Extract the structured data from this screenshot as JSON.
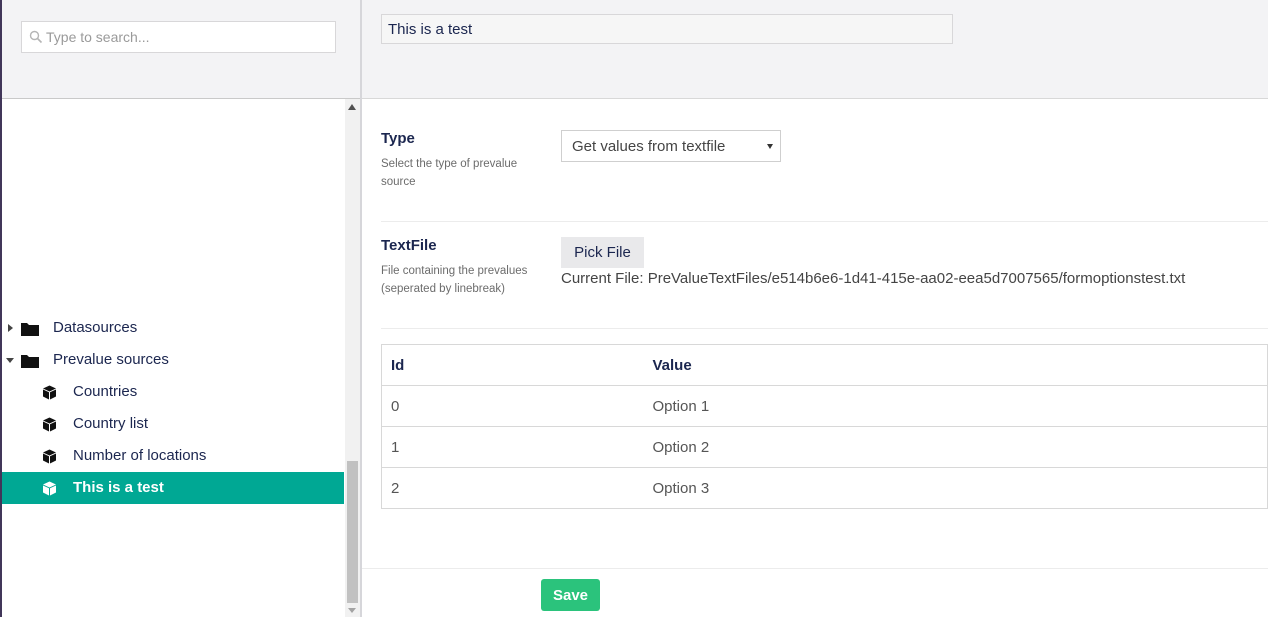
{
  "search": {
    "placeholder": "Type to search..."
  },
  "tree": {
    "items": [
      {
        "label": "Datasources",
        "icon": "folder-icon",
        "expanded": false
      },
      {
        "label": "Prevalue sources",
        "icon": "folder-icon",
        "expanded": true
      },
      {
        "label": "Countries",
        "icon": "box-icon"
      },
      {
        "label": "Country list",
        "icon": "box-icon"
      },
      {
        "label": "Number of locations",
        "icon": "box-icon"
      },
      {
        "label": "This is a test",
        "icon": "box-icon",
        "selected": true
      }
    ]
  },
  "editor": {
    "name_value": "This is a test",
    "type": {
      "label": "Type",
      "description": "Select the type of prevalue source",
      "selected": "Get values from textfile"
    },
    "textfile": {
      "label": "TextFile",
      "description": "File containing the prevalues (seperated by linebreak)",
      "pick_label": "Pick File",
      "current_file": "Current File: PreValueTextFiles/e514b6e6-1d41-415e-aa02-eea5d7007565/formoptionstest.txt"
    },
    "table": {
      "headers": [
        "Id",
        "Value"
      ],
      "rows": [
        {
          "id": "0",
          "value": "Option 1"
        },
        {
          "id": "1",
          "value": "Option 2"
        },
        {
          "id": "2",
          "value": "Option 3"
        }
      ]
    },
    "save_label": "Save"
  },
  "colors": {
    "accent": "#00a894",
    "save": "#2bc37c",
    "text": "#1b264f"
  }
}
